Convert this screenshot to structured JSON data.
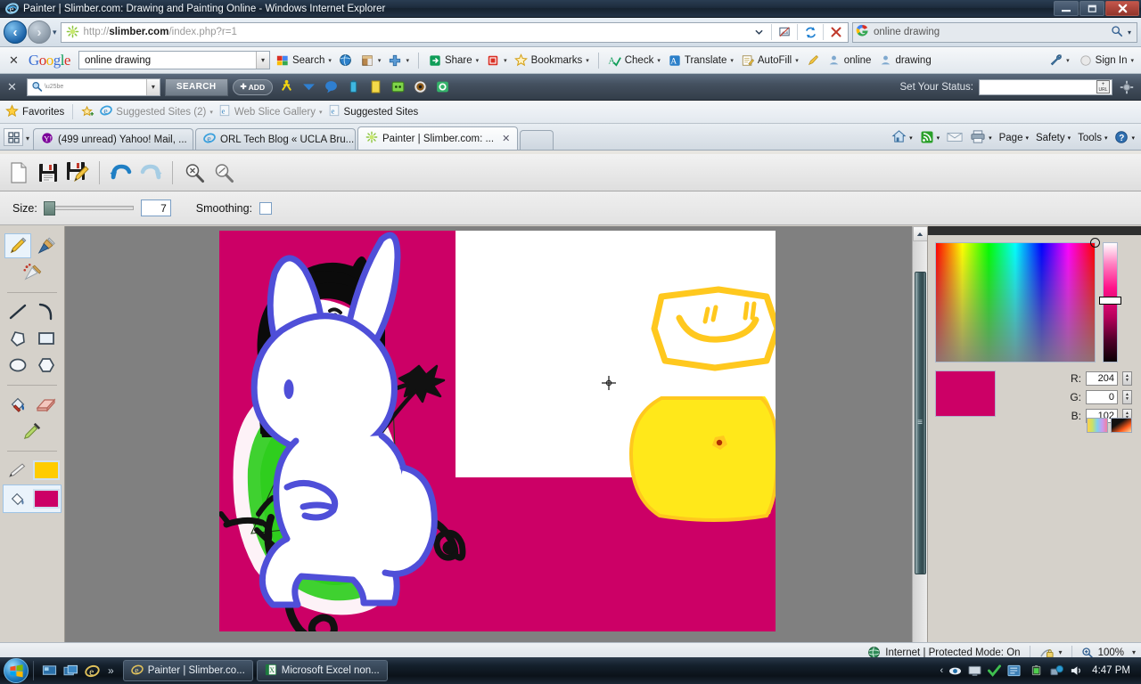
{
  "window": {
    "title": "Painter | Slimber.com: Drawing and Painting Online - Windows Internet Explorer",
    "minimize_label": "–",
    "maximize_label": "❐",
    "close_label": "✕"
  },
  "address_bar": {
    "url_prefix": "http://",
    "url_host": "slimber.com",
    "url_path": "/index.php?r=1",
    "back_label": "‹",
    "forward_label": "›",
    "dropdown_label": "▾",
    "compat_icon": "compatibility-view-icon",
    "refresh_label": "↺",
    "stop_label": "✕"
  },
  "search_box": {
    "value": "online drawing",
    "provider_icon": "google-icon",
    "go_label": "⌕",
    "dropdown_label": "▾"
  },
  "google_toolbar": {
    "close_label": "✕",
    "logo": [
      "G",
      "o",
      "o",
      "g",
      "l",
      "e"
    ],
    "query": "online drawing",
    "dropdown_label": "▾",
    "items": [
      {
        "label": "Search",
        "icon": "google-search-icon",
        "caret": "▾"
      },
      {
        "label": "",
        "icon": "translate-globe-icon",
        "caret": ""
      },
      {
        "label": "",
        "icon": "popup-blocker-icon",
        "caret": "▾"
      },
      {
        "label": "",
        "icon": "plus-tools-icon",
        "caret": "▾"
      },
      {
        "label": "Share",
        "icon": "share-icon",
        "caret": "▾"
      },
      {
        "label": "",
        "icon": "highlight-icon",
        "caret": "▾"
      },
      {
        "label": "Bookmarks",
        "icon": "star-icon",
        "caret": "▾"
      },
      {
        "label": "Check",
        "icon": "spellcheck-icon",
        "caret": "▾"
      },
      {
        "label": "Translate",
        "icon": "translate-icon",
        "caret": "▾"
      },
      {
        "label": "AutoFill",
        "icon": "autofill-icon",
        "caret": "▾"
      },
      {
        "label": "",
        "icon": "pencil-highlight-icon",
        "caret": ""
      },
      {
        "label": "online",
        "icon": "person-icon",
        "caret": ""
      },
      {
        "label": "drawing",
        "icon": "person-icon",
        "caret": ""
      }
    ],
    "settings": {
      "icon": "wrench-icon",
      "caret": "▾"
    },
    "sign_in": {
      "label": "Sign In",
      "icon": "signin-icon",
      "caret": "▾"
    }
  },
  "blue_toolbar": {
    "close_label": "✕",
    "search_value": "",
    "dropdown_label": "▾",
    "search_button": "SEARCH",
    "add_button": "ADD",
    "add_plus": "✚",
    "icons": [
      "walking-man-icon",
      "mail-chevron-icon",
      "chat-bubble-icon",
      "battery-icon",
      "notes-icon",
      "green-window-icon",
      "target-icon",
      "refresh-icon"
    ],
    "status_label": "Set Your Status:",
    "status_value": "",
    "url_button": "URL",
    "gear_icon": "gear-icon"
  },
  "favorites_bar": {
    "favorites_label": "Favorites",
    "favorites_icon": "star-icon",
    "add_icon": "add-favorite-icon",
    "items": [
      {
        "label": "Suggested Sites (2)",
        "icon": "ie-icon",
        "caret": "▾",
        "dim": true
      },
      {
        "label": "Web Slice Gallery",
        "icon": "ie-page-icon",
        "caret": "▾",
        "dim": true
      },
      {
        "label": "Suggested Sites",
        "icon": "ie-page-icon",
        "caret": "",
        "dim": false
      }
    ]
  },
  "tabs": {
    "quicktabs_icon": "quick-tabs-icon",
    "quicktabs_caret": "▾",
    "items": [
      {
        "label": "(499 unread) Yahoo! Mail, ...",
        "icon": "yahoo-icon",
        "active": false,
        "close": ""
      },
      {
        "label": "ORL Tech Blog « UCLA Bru...",
        "icon": "ie-icon",
        "active": false,
        "close": ""
      },
      {
        "label": "Painter | Slimber.com: ...",
        "icon": "slimber-icon",
        "active": true,
        "close": "✕"
      }
    ],
    "tools": [
      {
        "label": "",
        "icon": "home-icon",
        "caret": "▾"
      },
      {
        "label": "",
        "icon": "feeds-icon",
        "caret": "▾"
      },
      {
        "label": "",
        "icon": "mail-icon",
        "caret": ""
      },
      {
        "label": "",
        "icon": "print-icon",
        "caret": "▾"
      },
      {
        "label": "Page",
        "icon": "",
        "caret": "▾"
      },
      {
        "label": "Safety",
        "icon": "",
        "caret": "▾"
      },
      {
        "label": "Tools",
        "icon": "",
        "caret": "▾"
      },
      {
        "label": "",
        "icon": "help-icon",
        "caret": "▾"
      }
    ],
    "overflow": "»"
  },
  "app": {
    "toolbar": [
      {
        "name": "new-document-button",
        "icon": "new-page-icon"
      },
      {
        "name": "save-button",
        "icon": "floppy-disk-icon"
      },
      {
        "name": "save-as-button",
        "icon": "floppy-disk-pencil-icon"
      },
      {
        "name": "undo-button",
        "icon": "undo-arrow-icon"
      },
      {
        "name": "redo-button",
        "icon": "redo-arrow-icon"
      },
      {
        "name": "zoom-in-button",
        "icon": "magnifier-plus-icon"
      },
      {
        "name": "zoom-out-button",
        "icon": "magnifier-minus-icon"
      }
    ],
    "options": {
      "size_label": "Size:",
      "size_value": "7",
      "smoothing_label": "Smoothing:",
      "smoothing_checked": false
    },
    "tools": [
      {
        "name": "pencil-tool",
        "icon": "pencil-icon",
        "selected": true
      },
      {
        "name": "brush-tool",
        "icon": "paintbrush-icon",
        "selected": false
      },
      {
        "name": "airbrush-tool",
        "icon": "spray-brush-icon",
        "selected": false
      },
      {
        "name": "line-tool",
        "icon": "line-icon",
        "selected": false
      },
      {
        "name": "curve-tool",
        "icon": "curve-icon",
        "selected": false
      },
      {
        "name": "polygon-tool",
        "icon": "polygon-icon",
        "selected": false
      },
      {
        "name": "rectangle-tool",
        "icon": "rectangle-icon",
        "selected": false
      },
      {
        "name": "ellipse-tool",
        "icon": "ellipse-icon",
        "selected": false
      },
      {
        "name": "hexagon-tool",
        "icon": "hexagon-icon",
        "selected": false
      },
      {
        "name": "fill-tool",
        "icon": "paint-bucket-icon",
        "selected": false
      },
      {
        "name": "eraser-tool",
        "icon": "eraser-icon",
        "selected": false
      },
      {
        "name": "eyedropper-tool",
        "icon": "eyedropper-icon",
        "selected": false
      }
    ],
    "stroke_row": {
      "icon": "pen-stroke-icon",
      "color": "#FFCC00",
      "selected": false
    },
    "fill_row": {
      "icon": "paint-bucket-icon",
      "color": "#CC0066",
      "selected": true
    },
    "scrollbar": {
      "up_arrow": "▲",
      "grip": "≡"
    },
    "canvas_cursor": "crosshair-cursor"
  },
  "color_panel": {
    "r_label": "R:",
    "r_value": "204",
    "g_label": "G:",
    "g_value": "0",
    "b_label": "B:",
    "b_value": "102",
    "current_color": "#CC0066",
    "spin_up": "▲",
    "spin_down": "▼",
    "swatch_button_icon": "palette-swatches-icon",
    "gradient_button_icon": "gradient-picker-icon"
  },
  "drawing": {
    "background_color": "#CC0066",
    "white_panel_color": "#FFFFFF",
    "figure_hair_color": "#000000",
    "figure_face_color": "#FFFFFF",
    "figure_body_color": "#2FCE1E",
    "rabbit_outline_color": "#4F4FD8",
    "rabbit_fill_color": "#FFFFFF",
    "yellow_char_color": "#FFE81A",
    "yellow_char_outline": "#FFC81E",
    "yellow_char_dot": "#B03000"
  },
  "status_bar": {
    "zone_icon": "globe-icon",
    "zone_text": "Internet | Protected Mode: On",
    "privacy_icon": "privacy-lock-icon",
    "privacy_caret": "▾",
    "zoom_icon": "magnifier-icon",
    "zoom_level": "100%",
    "zoom_caret": "▾"
  },
  "taskbar": {
    "start_icon": "windows-start-orb",
    "quick_launch": [
      {
        "name": "show-desktop-icon"
      },
      {
        "name": "switch-windows-icon"
      },
      {
        "name": "internet-explorer-icon"
      }
    ],
    "overflow": "»",
    "tasks": [
      {
        "label": "Painter | Slimber.co...",
        "icon": "ie-icon",
        "active": true
      },
      {
        "label": "Microsoft Excel non...",
        "icon": "excel-icon",
        "active": false
      }
    ],
    "tray": [
      {
        "name": "tray-expand-icon",
        "glyph": "‹"
      },
      {
        "name": "eye-icon"
      },
      {
        "name": "monitor-icon"
      },
      {
        "name": "green-check-icon"
      },
      {
        "name": "blue-app-icon"
      },
      {
        "name": "battery-icon"
      },
      {
        "name": "network-icon"
      },
      {
        "name": "volume-icon"
      }
    ],
    "clock": "4:47 PM"
  }
}
